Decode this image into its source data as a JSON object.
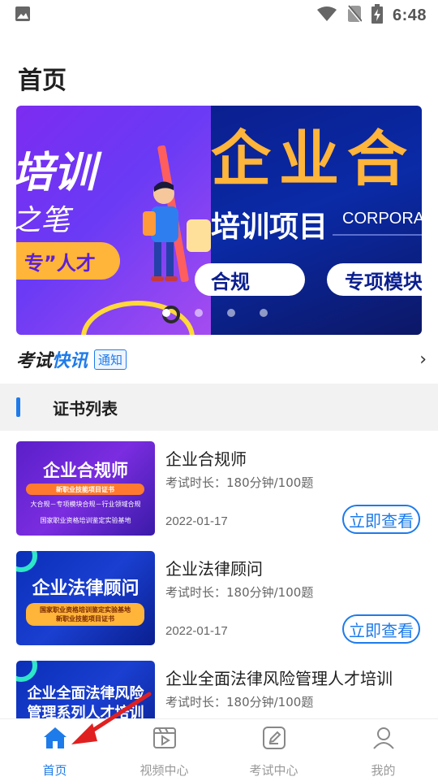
{
  "status_bar": {
    "time": "6:48",
    "icons": [
      "image-icon",
      "wifi-icon",
      "no-sim-icon",
      "battery-charging-icon"
    ]
  },
  "page_title": "首页",
  "banner": {
    "slide_a": {
      "big": "培训",
      "mid": "之笔",
      "pill": "专”人才"
    },
    "slide_b": {
      "big": "企业合",
      "line": "培训项目",
      "en": "CORPORA",
      "pill1": "合规",
      "pill2": "专项模块"
    },
    "dots": 4,
    "active_dot": 0
  },
  "news": {
    "logo_a": "考试",
    "logo_b": "快讯",
    "tag": "通知",
    "arrow": "›"
  },
  "section": {
    "title": "证书列表"
  },
  "cards": [
    {
      "title": "企业合规师",
      "meta": "考试时长：180分钟/100题",
      "date": "2022-01-17",
      "button": "立即查看",
      "thumb": {
        "title": "企业合规师",
        "bar": "新职业技能项目证书",
        "sub": "大合规－专项模块合规－行业领域合规",
        "foot": "国家职业资格培训鉴定实验基地"
      }
    },
    {
      "title": "企业法律顾问",
      "meta": "考试时长：180分钟/100题",
      "date": "2022-01-17",
      "button": "立即查看",
      "thumb": {
        "title": "企业法律顾问",
        "bar": "国家职业资格培训鉴定实验基地",
        "sub": "新职业技能项目证书"
      }
    },
    {
      "title": "企业全面法律风险管理人才培训",
      "meta": "考试时长：180分钟/100题",
      "thumb": {
        "title1": "企业全面法律风险",
        "title2": "管理系列人才培训"
      }
    }
  ],
  "tabs": [
    {
      "label": "首页",
      "icon": "home-icon",
      "active": true
    },
    {
      "label": "视频中心",
      "icon": "video-icon",
      "active": false
    },
    {
      "label": "考试中心",
      "icon": "exam-icon",
      "active": false
    },
    {
      "label": "我的",
      "icon": "profile-icon",
      "active": false
    }
  ],
  "colors": {
    "accent": "#1e7bea",
    "annotation": "#e02020"
  }
}
